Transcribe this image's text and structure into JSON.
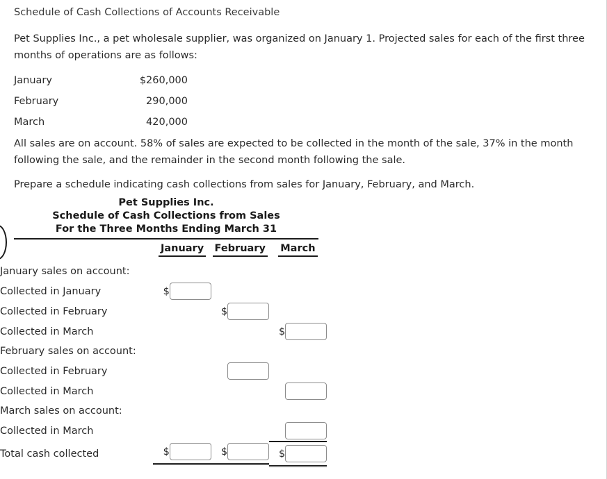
{
  "exercise": {
    "title": "Schedule of Cash Collections of Accounts Receivable",
    "intro": "Pet Supplies Inc., a pet wholesale supplier, was organized on January 1. Projected sales for each of the first three months of operations are as follows:",
    "terms": "All sales are on account. 58% of sales are expected to be collected in the month of the sale, 37% in the month following the sale, and the remainder in the second month following the sale.",
    "instruction": "Prepare a schedule indicating cash collections from sales for January, February, and March."
  },
  "projected_sales": {
    "rows": [
      {
        "month": "January",
        "amount": "$260,000"
      },
      {
        "month": "February",
        "amount": "290,000"
      },
      {
        "month": "March",
        "amount": "420,000"
      }
    ]
  },
  "schedule": {
    "company": "Pet Supplies Inc.",
    "statement": "Schedule of Cash Collections from Sales",
    "period": "For the Three Months Ending March 31",
    "columns": [
      "January",
      "February",
      "March"
    ],
    "rows": [
      {
        "type": "section",
        "label": "January sales on account:"
      },
      {
        "type": "entry",
        "label": "Collected in January",
        "column": 0,
        "dollar": true,
        "value": ""
      },
      {
        "type": "entry",
        "label": "Collected in February",
        "column": 1,
        "dollar": true,
        "value": ""
      },
      {
        "type": "entry",
        "label": "Collected in March",
        "column": 2,
        "dollar": true,
        "value": ""
      },
      {
        "type": "section",
        "label": "February sales on account:"
      },
      {
        "type": "entry",
        "label": "Collected in February",
        "column": 1,
        "dollar": false,
        "value": ""
      },
      {
        "type": "entry",
        "label": "Collected in March",
        "column": 2,
        "dollar": false,
        "value": ""
      },
      {
        "type": "section",
        "label": "March sales on account:"
      },
      {
        "type": "entry",
        "label": "Collected in March",
        "column": 2,
        "dollar": false,
        "value": ""
      },
      {
        "type": "total",
        "label": "Total cash collected",
        "dollar": true,
        "value": ""
      }
    ],
    "dollar_sign": "$",
    "input_placeholder": ""
  }
}
